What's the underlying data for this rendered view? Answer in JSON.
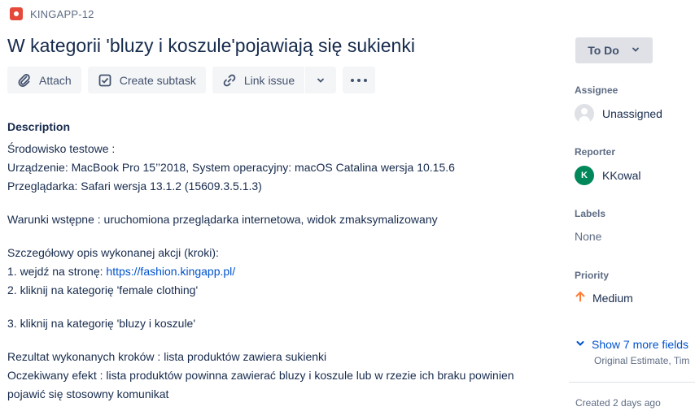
{
  "breadcrumb": {
    "issue_key": "KINGAPP-12",
    "icon": "bug-icon"
  },
  "issue": {
    "title": "W kategorii 'bluzy i koszule'pojawiają się sukienki"
  },
  "toolbar": {
    "attach_label": "Attach",
    "create_subtask_label": "Create subtask",
    "link_issue_label": "Link issue"
  },
  "description": {
    "heading": "Description",
    "env_heading": "Środowisko testowe :",
    "device": "Urządzenie: MacBook Pro 15’’2018, System operacyjny: macOS Catalina wersja 10.15.6",
    "browser": "Przeglądarka: Safari wersja 13.1.2 (15609.3.5.1.3)",
    "preconditions": "Warunki wstępne : uruchomiona przeglądarka internetowa, widok zmaksymalizowany",
    "steps_heading": "Szczegółowy opis wykonanej akcji (kroki):",
    "step1_prefix": "1. wejdź na stronę: ",
    "step1_link": "https://fashion.kingapp.pl/",
    "step2": "2. kliknij na kategorię 'female clothing'",
    "step3": "3. kliknij na kategorię 'bluzy i koszule'",
    "result": "Rezultat wykonanych kroków : lista produktów zawiera sukienki",
    "expected": "Oczekiwany efekt : lista produktów powinna zawierać bluzy i koszule lub w rzezie ich braku powinien pojawić się stosowny komunikat"
  },
  "sidebar": {
    "status": "To Do",
    "assignee_label": "Assignee",
    "assignee_value": "Unassigned",
    "reporter_label": "Reporter",
    "reporter_initial": "K",
    "reporter_value": "KKowal",
    "labels_label": "Labels",
    "labels_value": "None",
    "priority_label": "Priority",
    "priority_value": "Medium",
    "show_more": "Show 7 more fields",
    "more_fields_preview": "Original Estimate, Tim",
    "created": "Created 2 days ago"
  },
  "colors": {
    "accent": "#0052cc",
    "bug": "#e5493a",
    "reporter_avatar": "#00875a",
    "priority_medium": "#ff7b33"
  }
}
